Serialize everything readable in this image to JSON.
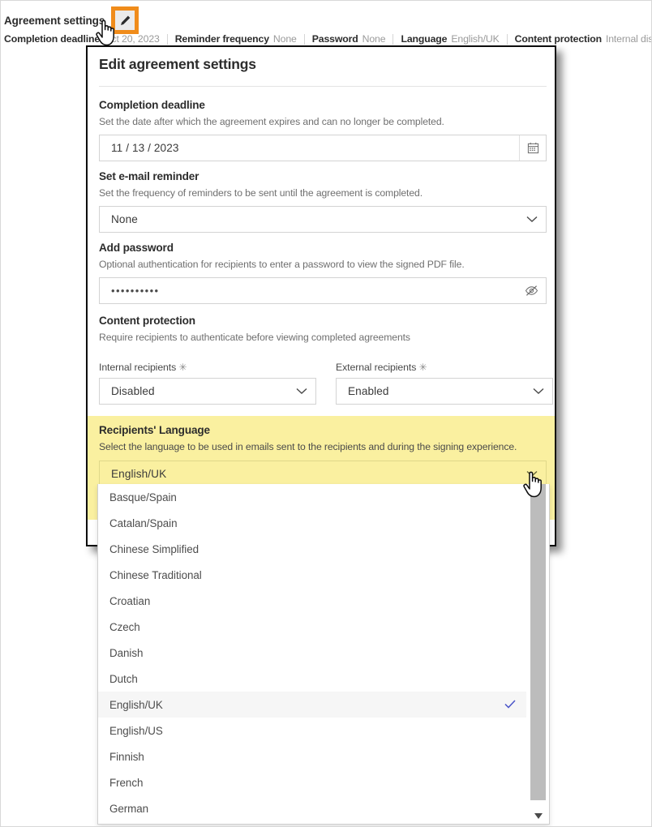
{
  "summary": {
    "title": "Agreement settings",
    "edit_icon": "pencil-edit-icon",
    "fields": [
      {
        "key": "Completion deadline",
        "value": "Oct 20, 2023"
      },
      {
        "key": "Reminder frequency",
        "value": "None"
      },
      {
        "key": "Password",
        "value": "None"
      },
      {
        "key": "Language",
        "value": "English/UK"
      },
      {
        "key": "Content protection",
        "value": "Internal disabled & External enabled"
      }
    ]
  },
  "dialog": {
    "title": "Edit agreement settings",
    "completion_deadline": {
      "label": "Completion deadline",
      "description": "Set the date after which the agreement expires and can no longer be completed.",
      "value": "11 / 13 / 2023",
      "icon": "calendar-icon"
    },
    "email_reminder": {
      "label": "Set e-mail reminder",
      "description": "Set the frequency of reminders to be sent until the agreement is completed.",
      "value": "None",
      "icon": "chevron-down-icon"
    },
    "add_password": {
      "label": "Add password",
      "description": "Optional authentication for recipients to enter a password to view the signed PDF file.",
      "value": "••••••••••",
      "icon": "eye-off-icon"
    },
    "content_protection": {
      "label": "Content protection",
      "description": "Require recipients to authenticate before viewing completed agreements",
      "internal": {
        "label": "Internal recipients",
        "required_marker": "✳",
        "value": "Disabled"
      },
      "external": {
        "label": "External recipients",
        "required_marker": "✳",
        "value": "Enabled"
      }
    },
    "recipients_language": {
      "label": "Recipients' Language",
      "description": "Select the language to be used in emails sent to the recipients and during the signing experience.",
      "value": "English/UK",
      "highlight_color": "#faf0a0",
      "icon": "chevron-down-icon"
    }
  },
  "language_dropdown": {
    "selected": "English/UK",
    "check_color": "#4a54c8",
    "options": [
      "Basque/Spain",
      "Catalan/Spain",
      "Chinese Simplified",
      "Chinese Traditional",
      "Croatian",
      "Czech",
      "Danish",
      "Dutch",
      "English/UK",
      "English/US",
      "Finnish",
      "French",
      "German"
    ],
    "scrollbar": {
      "down_arrow": "▼"
    }
  },
  "highlight_color": "#f08c1b"
}
